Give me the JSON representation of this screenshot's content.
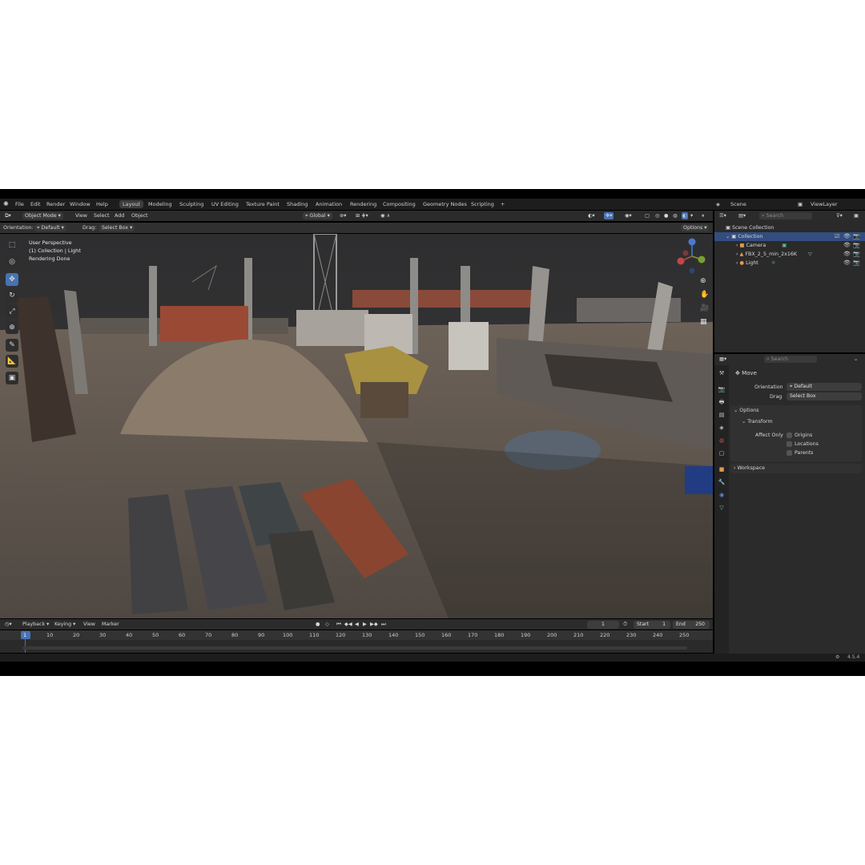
{
  "menu": {
    "items": [
      "File",
      "Edit",
      "Render",
      "Window",
      "Help"
    ],
    "workspaces": [
      "Layout",
      "Modeling",
      "Sculpting",
      "UV Editing",
      "Texture Paint",
      "Shading",
      "Animation",
      "Rendering",
      "Compositing",
      "Geometry Nodes",
      "Scripting"
    ],
    "add_tab": "+",
    "scene": "Scene",
    "view_layer": "ViewLayer"
  },
  "viewport": {
    "mode": "Object Mode",
    "menus": [
      "View",
      "Select",
      "Add",
      "Object"
    ],
    "orientation_label": "Orientation:",
    "orientation_value": "Default",
    "drag_label": "Drag:",
    "drag_value": "Select Box",
    "transform_space": "Global",
    "options": "Options",
    "overlay_lines": [
      "User Perspective",
      "(1) Collection | Light",
      "Rendering Done"
    ]
  },
  "outliner": {
    "search_placeholder": "Search",
    "scene_collection": "Scene Collection",
    "collection": "Collection",
    "objects": [
      "Camera",
      "FBX_2_5_min_2x16K",
      "Light"
    ]
  },
  "properties": {
    "search_placeholder": "Search",
    "tool_name": "Move",
    "orientation_label": "Orientation",
    "orientation_value": "Default",
    "drag_label": "Drag",
    "drag_value": "Select Box",
    "options_header": "Options",
    "transform_header": "Transform",
    "affect_only_label": "Affect Only",
    "affect_only": [
      "Origins",
      "Locations",
      "Parents"
    ],
    "workspace_header": "Workspace"
  },
  "timeline": {
    "menus": [
      "Playback",
      "Keying",
      "View",
      "Marker"
    ],
    "current_frame": "1",
    "start_label": "Start",
    "start_value": "1",
    "end_label": "End",
    "end_value": "250",
    "ticks": [
      "1",
      "10",
      "20",
      "30",
      "40",
      "50",
      "60",
      "70",
      "80",
      "90",
      "100",
      "110",
      "120",
      "130",
      "140",
      "150",
      "160",
      "170",
      "180",
      "190",
      "200",
      "210",
      "220",
      "230",
      "240",
      "250"
    ]
  },
  "status": {
    "version": "4.5.4"
  },
  "colors": {
    "accent": "#4772b3",
    "selection": "#334d80",
    "panel": "#2a2a2a",
    "header": "#2b2b2b"
  }
}
